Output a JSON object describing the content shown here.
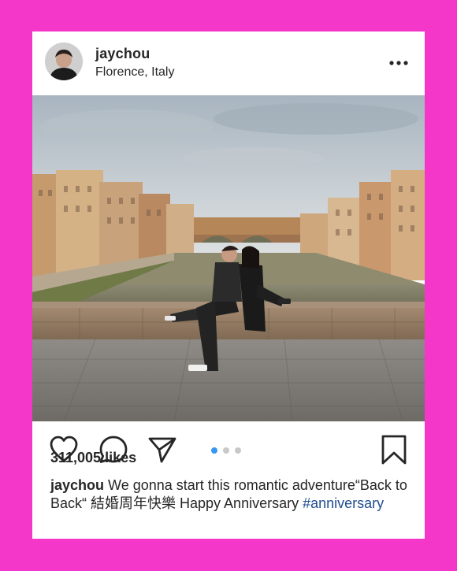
{
  "post": {
    "username": "jaychou",
    "location": "Florence, Italy",
    "likes": "311,005 likes",
    "caption": {
      "username": "jaychou",
      "text": "We gonna start this romantic adventure“Back to Back“ 結婚周年快樂 Happy Anniversary",
      "hashtag": "#anniversary"
    },
    "carousel": {
      "total": 3,
      "active": 1
    }
  },
  "icons": {
    "more": "more-options-icon",
    "like": "heart-icon",
    "comment": "comment-bubble-icon",
    "share": "paper-plane-icon",
    "save": "bookmark-icon"
  },
  "colors": {
    "background": "#f537c9",
    "card": "#ffffff",
    "text": "#262626",
    "hashtag": "#1f4d8f",
    "active_dot": "#3897f0",
    "inactive_dot": "#c8c8c8"
  }
}
